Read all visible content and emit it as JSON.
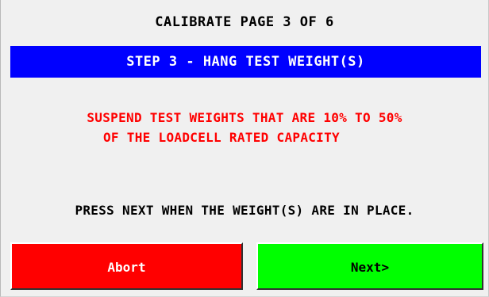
{
  "header": {
    "title": "CALIBRATE PAGE 3 OF 6"
  },
  "step": {
    "label": "STEP 3 - HANG TEST WEIGHT(S)",
    "background_color": "#0000ff",
    "text_color": "#ffffff"
  },
  "instruction": {
    "line1": "SUSPEND TEST WEIGHTS THAT ARE 10% TO 50%",
    "line2": "OF THE LOADCELL RATED CAPACITY",
    "text_color": "#ff0000"
  },
  "prompt": {
    "text": "PRESS NEXT WHEN THE WEIGHT(S) ARE IN PLACE."
  },
  "buttons": {
    "abort": {
      "label": "Abort",
      "background_color": "#ff0000",
      "text_color": "#ffffff"
    },
    "next": {
      "label": "Next>",
      "background_color": "#00ff00",
      "text_color": "#000000"
    }
  }
}
